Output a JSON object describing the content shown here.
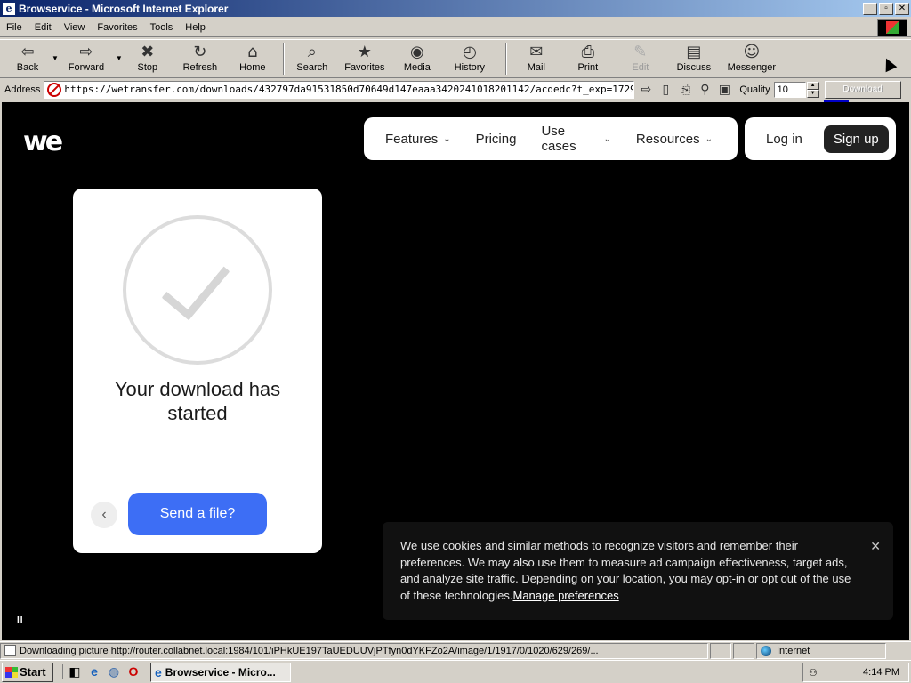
{
  "window": {
    "title": "Browservice - Microsoft Internet Explorer",
    "app_icon": "e",
    "btn_min": "_",
    "btn_max": "▫",
    "btn_close": "✕"
  },
  "menubar": {
    "items": [
      {
        "label": "File"
      },
      {
        "label": "Edit"
      },
      {
        "label": "View"
      },
      {
        "label": "Favorites"
      },
      {
        "label": "Tools"
      },
      {
        "label": "Help"
      }
    ]
  },
  "toolbar": {
    "back": "Back",
    "forward": "Forward",
    "stop": "Stop",
    "refresh": "Refresh",
    "home": "Home",
    "search": "Search",
    "favorites": "Favorites",
    "media": "Media",
    "history": "History",
    "mail": "Mail",
    "print": "Print",
    "edit": "Edit",
    "discuss": "Discuss",
    "messenger": "Messenger",
    "icons": {
      "back": "⇦",
      "forward": "⇨",
      "stop": "✖",
      "refresh": "↻",
      "home": "⌂",
      "search": "⌕",
      "favorites": "★",
      "media": "◉",
      "history": "◴",
      "mail": "✉",
      "print": "⎙",
      "edit": "✎",
      "discuss": "▤",
      "messenger": "☺"
    }
  },
  "address": {
    "label": "Address",
    "url": "https://wetransfer.com/downloads/432797da91531850d70649d147eaaa342024101820114​2/acdedc?t_exp=1729",
    "go_icon": "⇨",
    "quality_label": "Quality",
    "quality_value": "10",
    "download_label": "Download"
  },
  "page": {
    "logo": "we",
    "nav": [
      {
        "label": "Features",
        "has_dropdown": true
      },
      {
        "label": "Pricing",
        "has_dropdown": false
      },
      {
        "label": "Use cases",
        "has_dropdown": true
      },
      {
        "label": "Resources",
        "has_dropdown": true
      }
    ],
    "chevron": "⌄",
    "login": "Log in",
    "signup": "Sign up",
    "card": {
      "title": "Your download has started",
      "back_icon": "‹",
      "send_label": "Send a file?"
    },
    "pause": "II",
    "cookie": {
      "text": "We use cookies and similar methods to recognize visitors and remember their preferences. We may also use them to measure ad campaign effectiveness, target ads, and analyze site traffic. Depending on your location, you may opt-in or opt out of the use of these technologies.",
      "link": "Manage preferences",
      "close_icon": "✕"
    }
  },
  "statusbar": {
    "text": "Downloading picture http://router.collabnet.local:1984/101/iPHkUE197TaUEDUUVjPTfyn0dYKFZo2A/image/1/1917/0/1020/629/269/...",
    "zone": "Internet"
  },
  "taskbar": {
    "start": "Start",
    "task": "Browservice - Micro...",
    "time": "4:14 PM",
    "quick_icons": [
      "◧",
      "e",
      "◍",
      "O"
    ]
  },
  "colors": {
    "send_button": "#3d6ef5",
    "page_bg": "#000000",
    "title_gradient_start": "#0a246a"
  }
}
